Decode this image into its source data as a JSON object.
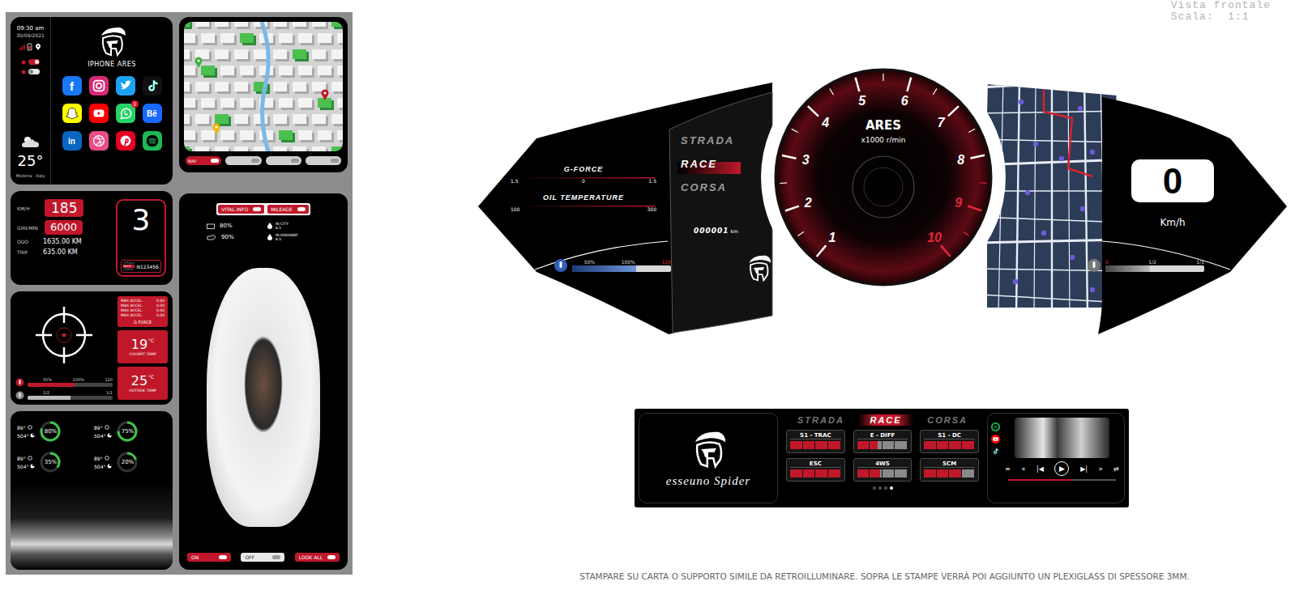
{
  "header": {
    "view": "Vista frontale",
    "scale": "Scala:  1:1"
  },
  "phone": {
    "time": "09:30 am",
    "date": "30/09/2021",
    "toggles": [
      {
        "on": true
      },
      {
        "on": false
      }
    ],
    "weather": {
      "temp": "25°",
      "place": "Modena - Italy"
    },
    "title": "IPHONE ARES",
    "apps": [
      {
        "kind": "facebook",
        "glyph": "f",
        "color": "#1877f2"
      },
      {
        "kind": "instagram",
        "color": "#d62976"
      },
      {
        "kind": "twitter",
        "color": "#1da1f2"
      },
      {
        "kind": "tiktok",
        "color": "#111111"
      },
      {
        "kind": "snapchat",
        "color": "#fffc00"
      },
      {
        "kind": "youtube",
        "color": "#ff0000"
      },
      {
        "kind": "whatsapp",
        "color": "#25d366",
        "badge": "3"
      },
      {
        "kind": "behance",
        "glyph": "Bē",
        "color": "#1769ff"
      },
      {
        "kind": "linkedin",
        "glyph": "in",
        "color": "#0a66c2"
      },
      {
        "kind": "dribbble",
        "color": "#ea4c89"
      },
      {
        "kind": "pinterest",
        "color": "#e60023"
      },
      {
        "kind": "spotify",
        "color": "#1db954"
      }
    ]
  },
  "nav": {
    "buttons": [
      {
        "label": "NAV",
        "on": true
      },
      {
        "on": false
      },
      {
        "on": false
      },
      {
        "on": false
      }
    ]
  },
  "drive": {
    "speed_label": "KM/H",
    "speed": "185",
    "rpm_label": "GIRI/MIN",
    "rpm": "6000",
    "odo_label": "ODO",
    "odo": "1635.00 KM",
    "trip_label": "TRIP",
    "trip": "635.00 KM",
    "gear": "3",
    "modes": [
      {
        "label": "STRADA",
        "selected": false
      },
      {
        "label": "RACE",
        "selected": true
      },
      {
        "label": "CORSA",
        "selected": false
      }
    ],
    "plate": "N123456"
  },
  "gforce": {
    "rows": [
      {
        "label": "MAX ACCEL.",
        "value": "0.00"
      },
      {
        "label": "MAX ACCEL.",
        "value": "0.00"
      },
      {
        "label": "MAX ACCEL.",
        "value": "0.00"
      },
      {
        "label": "MAX ACCEL.",
        "value": "0.00"
      }
    ],
    "title": "G FORCE"
  },
  "temps": [
    {
      "value": "19",
      "unit": "°C",
      "label": "COCKPIT TEMP"
    },
    {
      "value": "25",
      "unit": "°C",
      "label": "OUTSIDE TEMP"
    }
  ],
  "water": {
    "ticks": [
      "50%",
      "100%",
      "120"
    ],
    "level": 0.55
  },
  "fuel": {
    "ticks": [
      "1/2",
      "1/1"
    ],
    "level": 0.5
  },
  "tires": [
    {
      "temp": "89°",
      "pressure": "504°",
      "wear": "80%",
      "level": 0.8
    },
    {
      "temp": "89°",
      "pressure": "504°",
      "wear": "75%",
      "level": 0.75
    },
    {
      "temp": "89°",
      "pressure": "504°",
      "wear": "35%",
      "level": 0.35
    },
    {
      "temp": "89°",
      "pressure": "504°",
      "wear": "20%",
      "level": 0.2
    }
  ],
  "vital": {
    "tabs": [
      {
        "label": "VITAL INFO",
        "on": true
      },
      {
        "label": "MILEAGE",
        "on": true
      }
    ],
    "battery": "80%",
    "oil": "90%",
    "city_label": "IN CITY",
    "city": "6.5",
    "highway_label": "IN HIGHWAY",
    "highway": "8.5",
    "buttons": [
      {
        "label": "ON",
        "on": true
      },
      {
        "label": "OFF",
        "on": false
      },
      {
        "label": "LOOK ALL",
        "on": true
      }
    ]
  },
  "cluster": {
    "modes": [
      {
        "label": "STRADA",
        "selected": false
      },
      {
        "label": "RACE",
        "selected": true
      },
      {
        "label": "CORSA",
        "selected": false
      }
    ],
    "gforce": {
      "title": "G-FORCE",
      "scale": [
        "1.5",
        "0",
        "1.5"
      ]
    },
    "oil": {
      "title": "OIL TEMPERATURE",
      "scale": [
        "100",
        "300"
      ]
    },
    "odometer": "000001",
    "odo_unit": "km",
    "brand": "ARES",
    "unit": "x1000 r/min",
    "numbers": [
      {
        "label": "1",
        "red": false
      },
      {
        "label": "2",
        "red": false
      },
      {
        "label": "3",
        "red": false
      },
      {
        "label": "4",
        "red": false
      },
      {
        "label": "5",
        "red": false
      },
      {
        "label": "6",
        "red": false
      },
      {
        "label": "7",
        "red": false
      },
      {
        "label": "8",
        "red": false
      },
      {
        "label": "9",
        "red": true
      },
      {
        "label": "10",
        "red": true
      }
    ],
    "water": {
      "ticks": [
        "50%",
        "100%",
        "120"
      ],
      "level": 0.65
    },
    "speed": "0",
    "speed_unit": "Km/h",
    "fuel": {
      "ticks": [
        "0",
        "1/2",
        "1/1"
      ],
      "level": 0.45
    }
  },
  "console": {
    "brand": "esseuno Spider",
    "modes": [
      {
        "label": "STRADA",
        "selected": false
      },
      {
        "label": "RACE",
        "selected": true
      },
      {
        "label": "CORSA",
        "selected": false
      }
    ],
    "controls": [
      {
        "label": "S1 - TRAC",
        "level": 1
      },
      {
        "label": "E - DIFF",
        "level": 0.4
      },
      {
        "label": "S1 - DC",
        "level": 1
      },
      {
        "label": "ESC",
        "level": 1
      },
      {
        "label": "4WS",
        "level": 0.45
      },
      {
        "label": "SCM",
        "level": 0.75
      }
    ],
    "pages": [
      {
        "selected": false
      },
      {
        "selected": false
      },
      {
        "selected": false
      },
      {
        "selected": true
      }
    ],
    "sources": [
      {
        "kind": "spotify",
        "color": "#1db954"
      },
      {
        "kind": "youtube",
        "color": "#ff0000"
      },
      {
        "kind": "tiktok",
        "color": "#111111"
      }
    ],
    "player": [
      "≡",
      "«",
      "|◀",
      "▶",
      "▶|",
      "»",
      "⇄"
    ],
    "progress": 0.6
  },
  "note": "STAMPARE SU CARTA O SUPPORTO SIMILE DA RETROILLUMINARE. SOPRA LE STAMPE VERRÀ POI AGGIUNTO UN PLEXIGLASS DI SPESSORE 3MM."
}
